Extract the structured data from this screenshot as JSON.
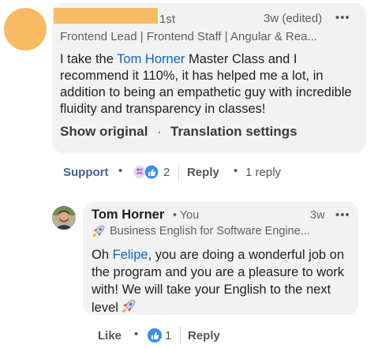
{
  "comment": {
    "connection_degree": "1st",
    "time": "3w (edited)",
    "more_label": "•••",
    "headline": "Frontend Lead | Frontend Staff | Angular & Rea...",
    "text_before": "I take the ",
    "mention": "Tom Horner",
    "text_after": " Master Class and I recommend it 110%, it has helped me a lot, in addition to being an empathetic guy with incredible fluidity and transparency in classes!",
    "show_original": "Show original",
    "separator": "·",
    "translation_settings": "Translation settings",
    "reaction_label": "Support",
    "reaction_count": "2",
    "reply_label": "Reply",
    "reply_count": "1 reply",
    "avatar_color": "#f8bb63"
  },
  "reply": {
    "author": "Tom Horner",
    "author_tag": "• You",
    "time": "3w",
    "more_label": "•••",
    "headline": "Business English for Software Engine...",
    "text_before": "Oh ",
    "mention": "Felipe",
    "text_after": ", you are doing a wonderful job on the program and you are a pleasure to work with! We will take your English to the next level",
    "like_label": "Like",
    "reaction_count": "1",
    "reply_label": "Reply"
  },
  "icons": {
    "reaction_pair": [
      "support-icon",
      "like-icon"
    ],
    "single_reaction": "like-icon",
    "rocket": "rocket-icon"
  },
  "colors": {
    "link_blue": "#0a66c2",
    "support_text": "#44639b",
    "bubble_bg": "#f2f2f2",
    "muted_text": "#5f5f5f"
  }
}
